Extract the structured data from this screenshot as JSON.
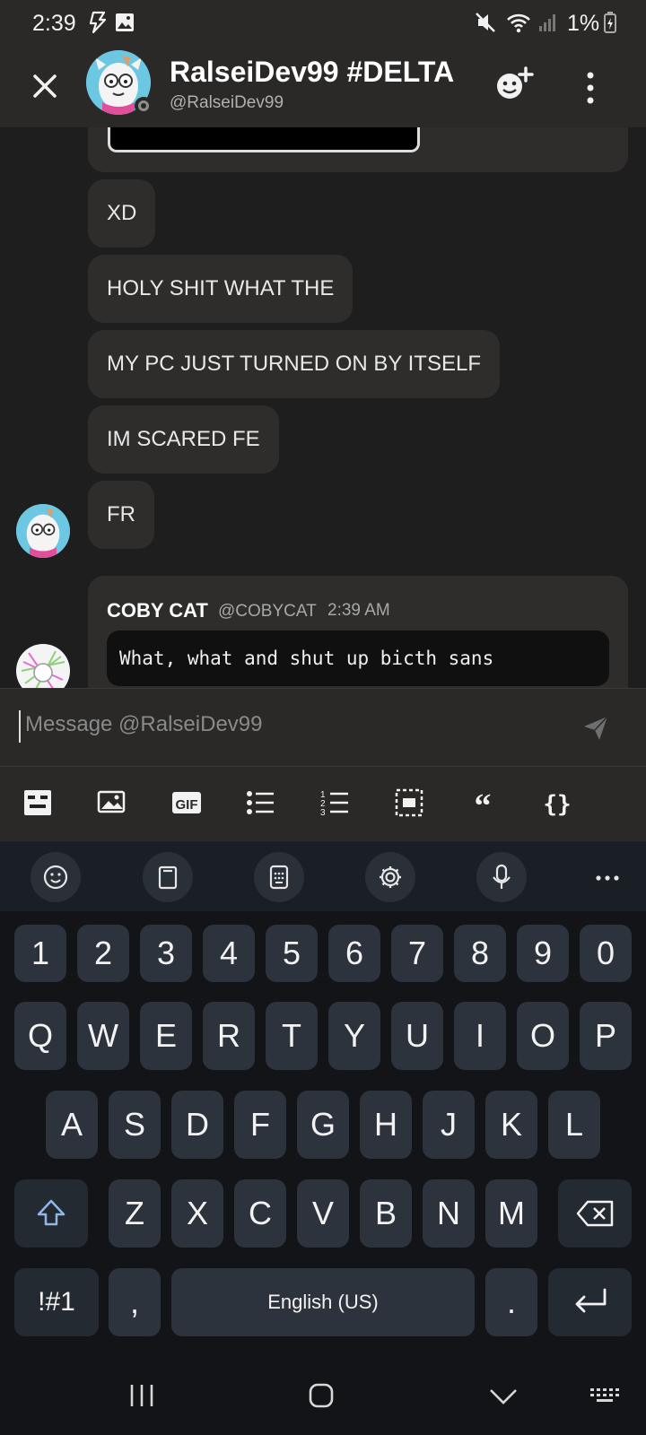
{
  "status_bar": {
    "time": "2:39",
    "battery": "1%",
    "icons": [
      "flash-icon",
      "image-notification-icon",
      "mute-icon",
      "wifi-icon",
      "signal-icon",
      "battery-charging-icon"
    ]
  },
  "header": {
    "title": "RalseiDev99 #DELTA",
    "handle": "@RalseiDev99",
    "close_icon": "close-icon",
    "add_icon": "add-friend-icon",
    "more_icon": "more-vertical-icon"
  },
  "messages": [
    {
      "text": "XD"
    },
    {
      "text": "HOLY SHIT WHAT THE"
    },
    {
      "text": "MY PC JUST TURNED ON BY ITSELF"
    },
    {
      "text": "IM SCARED FE"
    },
    {
      "text": "FR"
    }
  ],
  "reply": {
    "author": "COBY CAT",
    "handle": "@COBYCAT",
    "time": "2:39 AM",
    "code": "What, what and shut up bicth sans"
  },
  "composer": {
    "placeholder": "Message @RalseiDev99"
  },
  "format_toolbar": [
    "spoiler-icon",
    "image-icon",
    "gif-icon",
    "bullet-list-icon",
    "numbered-list-icon",
    "select-all-icon",
    "quote-icon",
    "code-braces-icon"
  ],
  "format_labels": {
    "gif": "GIF",
    "quote": "“",
    "code": "{}"
  },
  "keyboard": {
    "tools": [
      "emoji-icon",
      "clipboard-icon",
      "keyboard-mode-icon",
      "settings-icon",
      "microphone-icon"
    ],
    "number_row": [
      "1",
      "2",
      "3",
      "4",
      "5",
      "6",
      "7",
      "8",
      "9",
      "0"
    ],
    "row1": [
      "Q",
      "W",
      "E",
      "R",
      "T",
      "Y",
      "U",
      "I",
      "O",
      "P"
    ],
    "row2": [
      "A",
      "S",
      "D",
      "F",
      "G",
      "H",
      "J",
      "K",
      "L"
    ],
    "row3": [
      "Z",
      "X",
      "C",
      "V",
      "B",
      "N",
      "M"
    ],
    "symbols": "!#1",
    "comma": ",",
    "space": "English (US)",
    "period": "."
  }
}
